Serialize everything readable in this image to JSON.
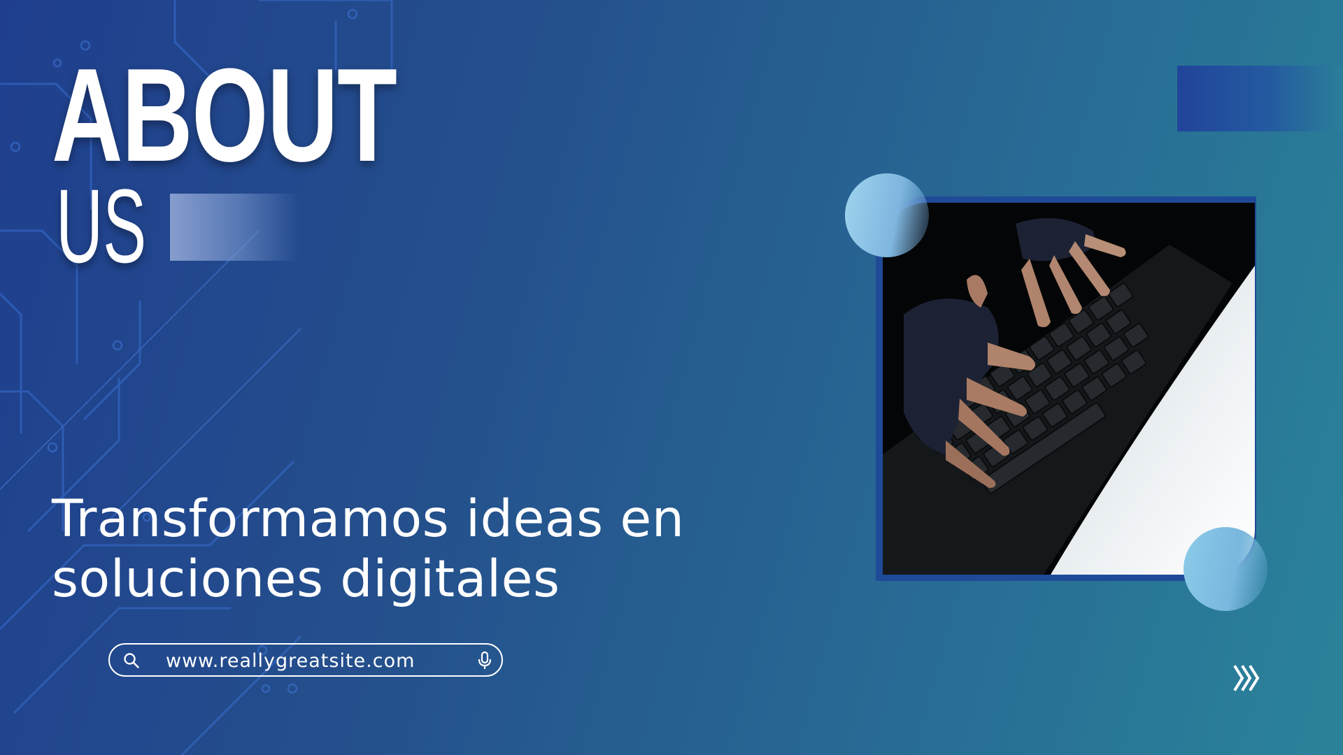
{
  "slide": {
    "title_line1": "ABOUT",
    "title_line2": "US",
    "tagline_line1": "Transformamos ideas en",
    "tagline_line2": "soluciones digitales",
    "search": {
      "icon": "search-icon",
      "url": "www.reallygreatsite.com",
      "mic_icon": "microphone-icon"
    },
    "photo": {
      "subject": "hands with fingerless gloves typing on a laptop keyboard"
    },
    "next_icon": "triple-chevron-right-icon",
    "colors": {
      "background_start": "#1f3f8e",
      "background_end": "#2a8399",
      "accent_light": "#9fd3ee",
      "text": "#ffffff"
    }
  }
}
